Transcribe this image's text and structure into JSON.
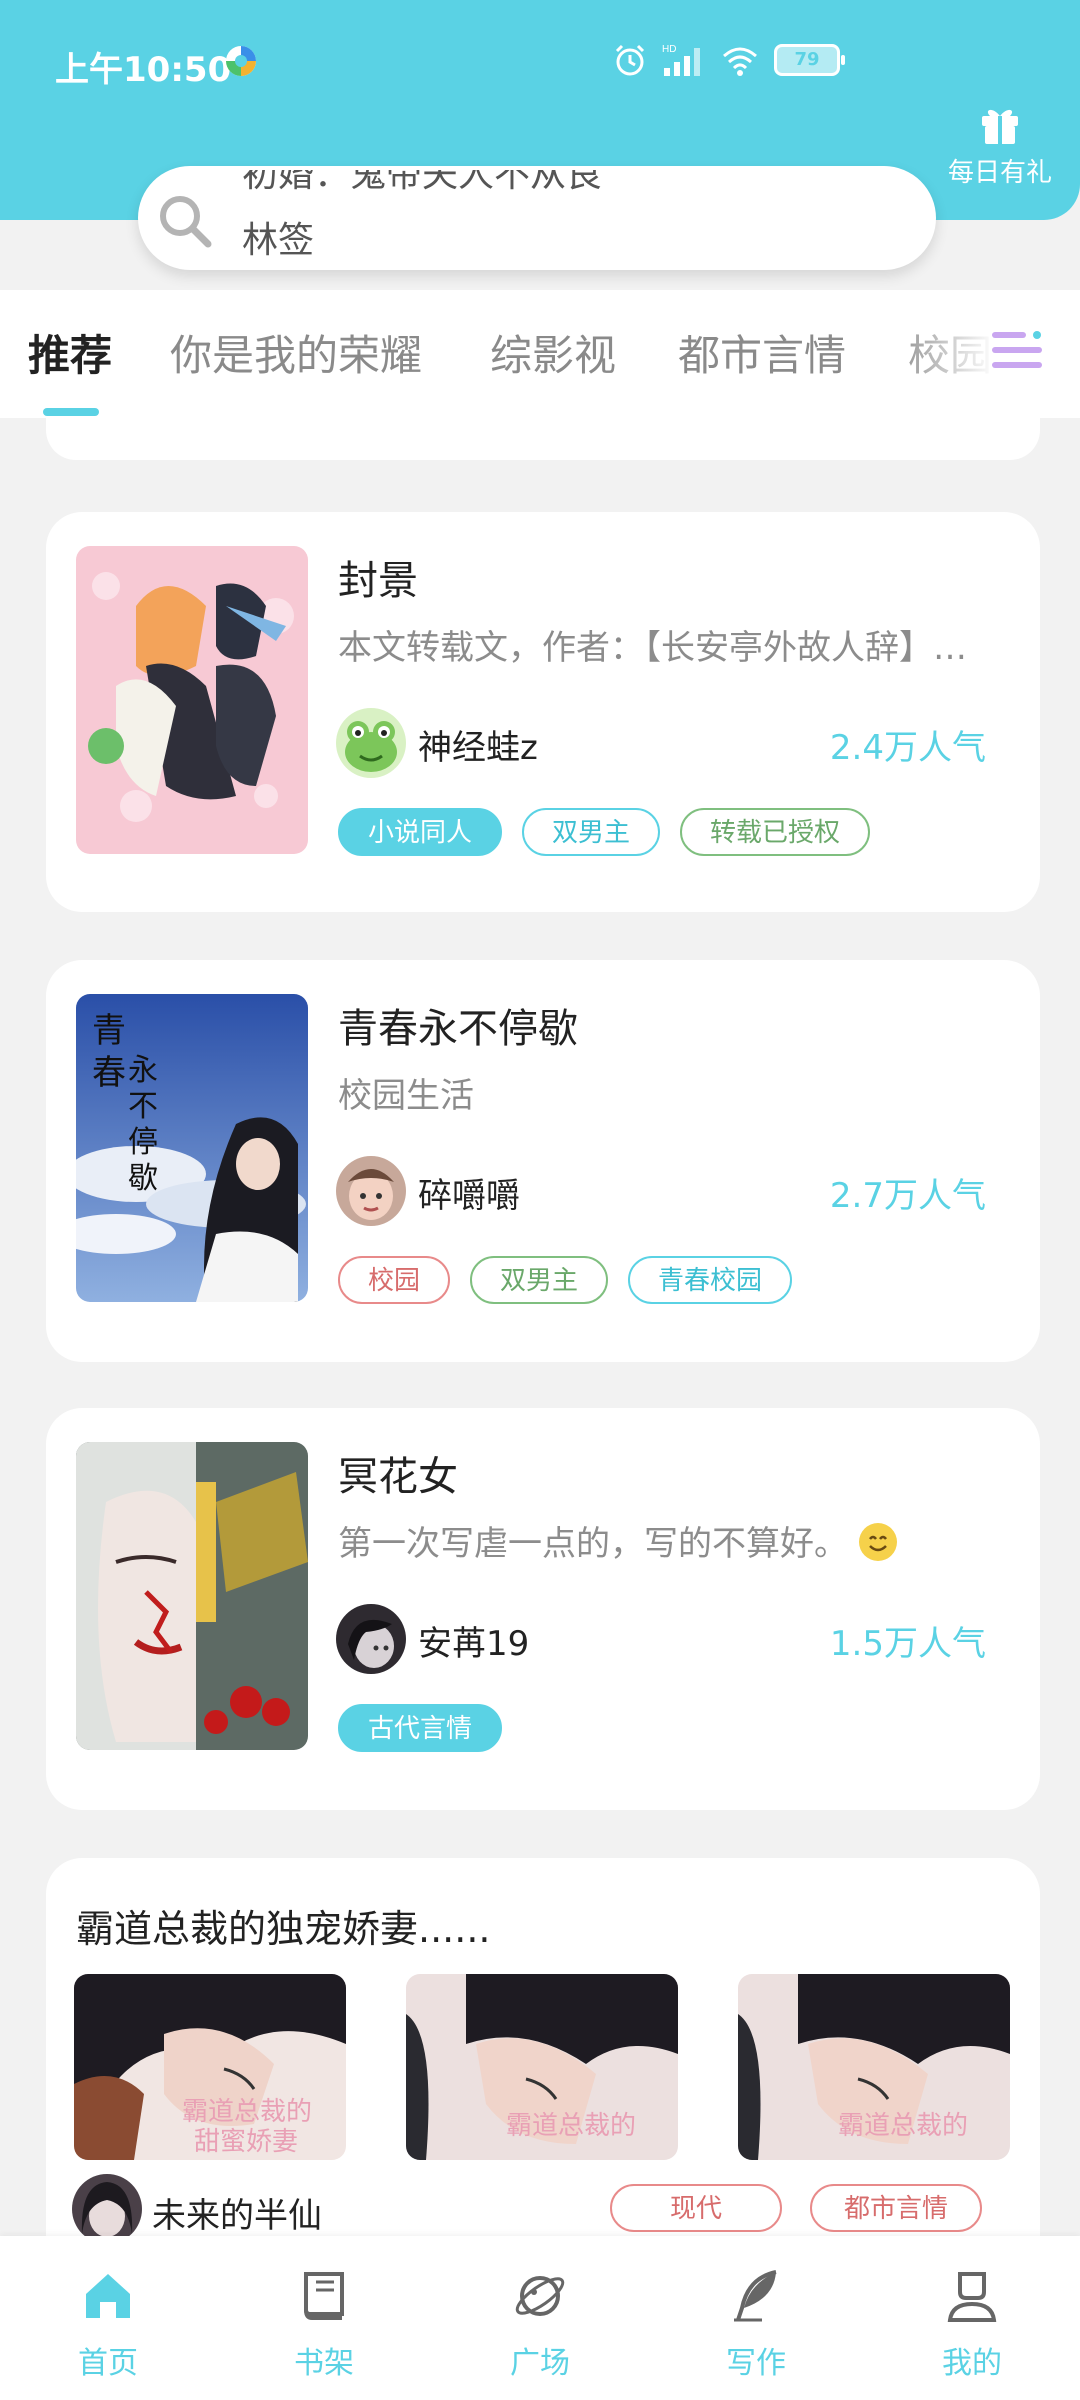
{
  "status_bar": {
    "time": "上午10:50",
    "battery": "79",
    "network": "HD"
  },
  "header": {
    "gift_label": "每日有礼",
    "accent_color": "#5ad2e4"
  },
  "search": {
    "line1": "初婚：鬼帝夫人不从良",
    "line2": "林签"
  },
  "tabs": [
    {
      "label": "推荐"
    },
    {
      "label": "你是我的荣耀"
    },
    {
      "label": "综影视"
    },
    {
      "label": "都市言情"
    },
    {
      "label": "校园"
    }
  ],
  "books": [
    {
      "title": "封景",
      "description": "本文转载文，作者：【长安亭外故人辞】…",
      "author": "神经蛙z",
      "popularity": "2.4万人气",
      "tags": [
        "小说同人",
        "双男主",
        "转载已授权"
      ]
    },
    {
      "title": "青春永不停歇",
      "description": "校园生活",
      "author": "碎嚼嚼",
      "popularity": "2.7万人气",
      "tags": [
        "校园",
        "双男主",
        "青春校园"
      ],
      "cover_text": [
        "青",
        "春",
        "永",
        "不",
        "停",
        "歇"
      ]
    },
    {
      "title": "冥花女",
      "description": "第一次写虐一点的，写的不算好。",
      "author": "安苒19",
      "popularity": "1.5万人气",
      "tags": [
        "古代言情"
      ]
    }
  ],
  "collection": {
    "title": "霸道总裁的独宠娇妻......",
    "cover_text": [
      "霸道总裁的",
      "甜蜜娇妻"
    ],
    "author": "未来的半仙",
    "tags": [
      "现代",
      "都市言情"
    ]
  },
  "bottom_nav": [
    {
      "label": "首页",
      "icon": "home-icon"
    },
    {
      "label": "书架",
      "icon": "bookshelf-icon"
    },
    {
      "label": "广场",
      "icon": "planet-icon"
    },
    {
      "label": "写作",
      "icon": "feather-icon"
    },
    {
      "label": "我的",
      "icon": "profile-icon"
    }
  ]
}
